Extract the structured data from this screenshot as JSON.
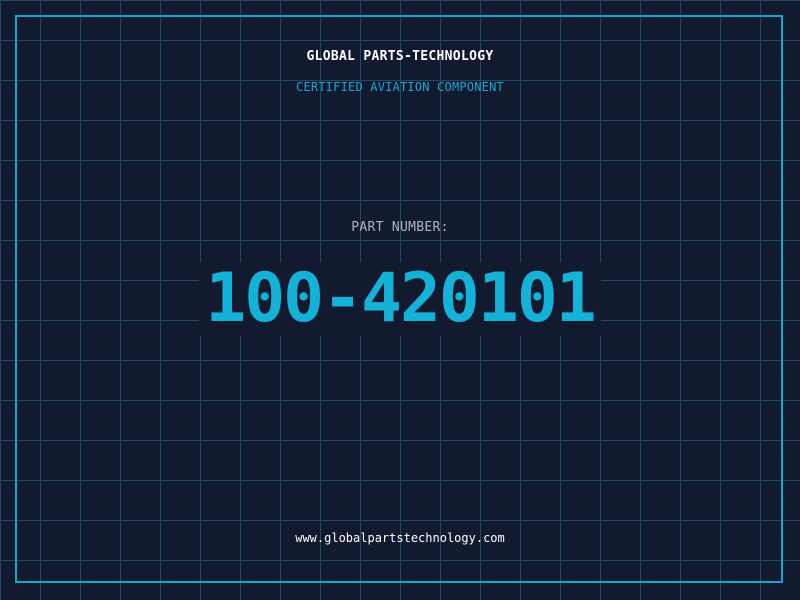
{
  "header": {
    "company": "GLOBAL PARTS-TECHNOLOGY",
    "subtitle": "CERTIFIED AVIATION COMPONENT"
  },
  "part": {
    "label": "PART NUMBER:",
    "number": "100-420101"
  },
  "footer": {
    "website": "www.globalpartstechnology.com"
  },
  "colors": {
    "background": "#111a2e",
    "grid": "#1f4a62",
    "accent": "#14b2d9",
    "border": "#17a6cc"
  }
}
